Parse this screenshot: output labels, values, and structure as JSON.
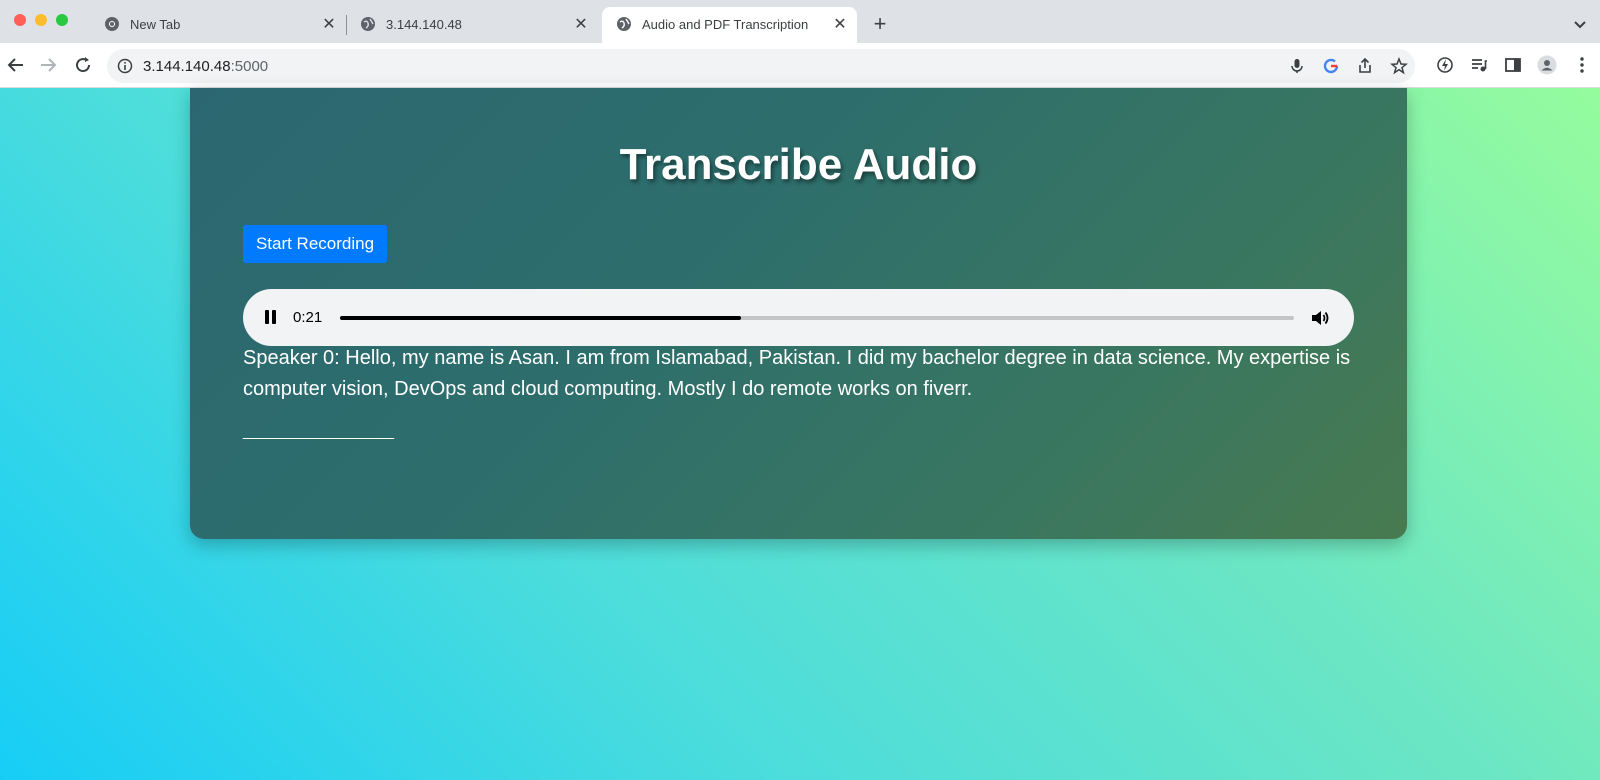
{
  "browser": {
    "tabs": [
      {
        "title": "New Tab",
        "icon": "chrome-icon",
        "active": false
      },
      {
        "title": "3.144.140.48",
        "icon": "globe-icon",
        "active": false
      },
      {
        "title": "Audio and PDF Transcription",
        "icon": "globe-icon",
        "active": true
      }
    ],
    "new_tab_label": "+",
    "address": {
      "host": "3.144.140.48",
      "port": ":5000"
    }
  },
  "page": {
    "title": "Transcribe Audio",
    "record_button": "Start Recording",
    "audio": {
      "current_time": "0:21",
      "progress_fraction": 0.42,
      "state": "playing"
    },
    "transcript": "Speaker 0: Hello, my name is Asan. I am from Islamabad, Pakistan. I did my bachelor degree in data science. My expertise is computer vision, DevOps and cloud computing. Mostly I do remote works on fiverr.",
    "separator": "___________________"
  },
  "colors": {
    "accent": "#007bff",
    "card_gradient_start": "#2c6771",
    "card_gradient_end": "#487a4f",
    "page_gradient_start": "#17cdf6",
    "page_gradient_end": "#95fc9d"
  }
}
